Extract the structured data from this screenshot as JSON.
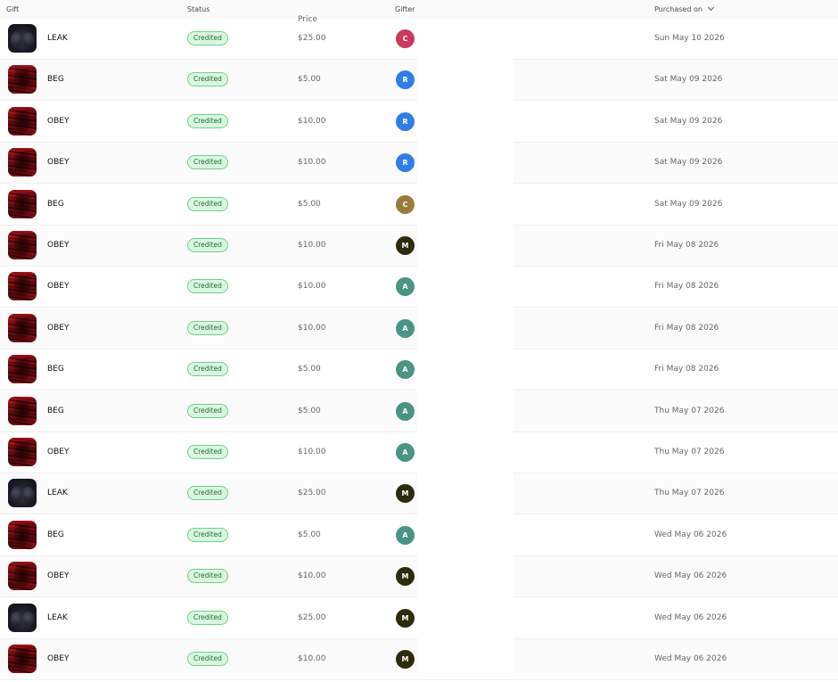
{
  "header": {
    "gift": "Gift",
    "status": "Status",
    "price": "Price",
    "gifter": "Gifter",
    "purchased_on": "Purchased on",
    "sort_icon": "chevron-down-icon"
  },
  "colors": {
    "badge_bg": "#d9f7e0",
    "badge_border": "#6fd28a",
    "badge_text": "#1e6e34"
  },
  "rows": [
    {
      "gift": "LEAK",
      "thumb": "dark",
      "status": "Credited",
      "price": "$25.00",
      "initial": "C",
      "avatar_color": "#c93a5e",
      "date": "Sun May 10 2026"
    },
    {
      "gift": "BEG",
      "thumb": "red",
      "status": "Credited",
      "price": "$5.00",
      "initial": "R",
      "avatar_color": "#2f7de8",
      "date": "Sat May 09 2026"
    },
    {
      "gift": "OBEY",
      "thumb": "red",
      "status": "Credited",
      "price": "$10.00",
      "initial": "R",
      "avatar_color": "#2f7de8",
      "date": "Sat May 09 2026"
    },
    {
      "gift": "OBEY",
      "thumb": "red",
      "status": "Credited",
      "price": "$10.00",
      "initial": "R",
      "avatar_color": "#2f7de8",
      "date": "Sat May 09 2026"
    },
    {
      "gift": "BEG",
      "thumb": "red",
      "status": "Credited",
      "price": "$5.00",
      "initial": "C",
      "avatar_color": "#9b7b3c",
      "date": "Sat May 09 2026"
    },
    {
      "gift": "OBEY",
      "thumb": "red",
      "status": "Credited",
      "price": "$10.00",
      "initial": "M",
      "avatar_color": "#2e2a0c",
      "date": "Fri May 08 2026"
    },
    {
      "gift": "OBEY",
      "thumb": "red",
      "status": "Credited",
      "price": "$10.00",
      "initial": "A",
      "avatar_color": "#4b9384",
      "date": "Fri May 08 2026"
    },
    {
      "gift": "OBEY",
      "thumb": "red",
      "status": "Credited",
      "price": "$10.00",
      "initial": "A",
      "avatar_color": "#4b9384",
      "date": "Fri May 08 2026"
    },
    {
      "gift": "BEG",
      "thumb": "red",
      "status": "Credited",
      "price": "$5.00",
      "initial": "A",
      "avatar_color": "#4b9384",
      "date": "Fri May 08 2026"
    },
    {
      "gift": "BEG",
      "thumb": "red",
      "status": "Credited",
      "price": "$5.00",
      "initial": "A",
      "avatar_color": "#4b9384",
      "date": "Thu May 07 2026"
    },
    {
      "gift": "OBEY",
      "thumb": "red",
      "status": "Credited",
      "price": "$10.00",
      "initial": "A",
      "avatar_color": "#4b9384",
      "date": "Thu May 07 2026"
    },
    {
      "gift": "LEAK",
      "thumb": "dark",
      "status": "Credited",
      "price": "$25.00",
      "initial": "M",
      "avatar_color": "#2e2a0c",
      "date": "Thu May 07 2026"
    },
    {
      "gift": "BEG",
      "thumb": "red",
      "status": "Credited",
      "price": "$5.00",
      "initial": "A",
      "avatar_color": "#4b9384",
      "date": "Wed May 06 2026"
    },
    {
      "gift": "OBEY",
      "thumb": "red",
      "status": "Credited",
      "price": "$10.00",
      "initial": "M",
      "avatar_color": "#2e2a0c",
      "date": "Wed May 06 2026"
    },
    {
      "gift": "LEAK",
      "thumb": "dark",
      "status": "Credited",
      "price": "$25.00",
      "initial": "M",
      "avatar_color": "#2e2a0c",
      "date": "Wed May 06 2026"
    },
    {
      "gift": "OBEY",
      "thumb": "red",
      "status": "Credited",
      "price": "$10.00",
      "initial": "M",
      "avatar_color": "#2e2a0c",
      "date": "Wed May 06 2026"
    }
  ]
}
